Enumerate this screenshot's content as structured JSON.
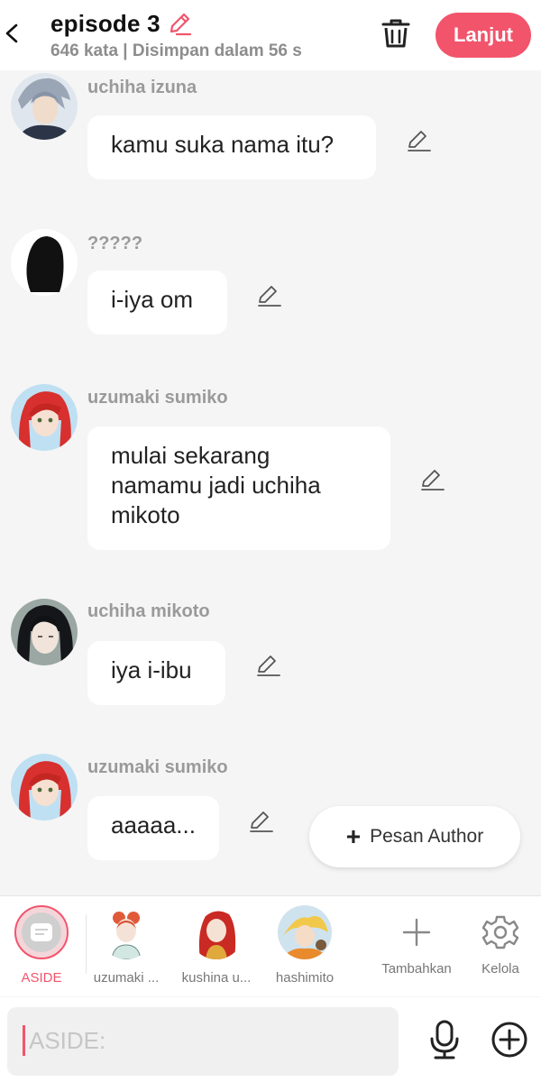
{
  "header": {
    "title": "episode 3",
    "subtitle": "646 kata | Disimpan dalam 56 s",
    "next_label": "Lanjut"
  },
  "messages": [
    {
      "name": "uchiha izuna",
      "text": "kamu suka nama itu?"
    },
    {
      "name": "?????",
      "text": "i-iya om"
    },
    {
      "name": "uzumaki sumiko",
      "text": "mulai sekarang namamu jadi uchiha mikoto"
    },
    {
      "name": "uchiha mikoto",
      "text": "iya i-ibu"
    },
    {
      "name": "uzumaki sumiko",
      "text": "aaaaa..."
    }
  ],
  "fab": {
    "label": "Pesan Author"
  },
  "characters": {
    "aside": "ASIDE",
    "items": [
      {
        "label": "uzumaki ..."
      },
      {
        "label": "kushina u..."
      },
      {
        "label": "hashimito"
      }
    ],
    "add_label": "Tambahkan",
    "manage_label": "Kelola"
  },
  "input": {
    "placeholder": "ASIDE:"
  },
  "colors": {
    "accent": "#f2546c",
    "background": "#f5f5f5",
    "bubble": "#ffffff",
    "name": "#9a9a9a"
  }
}
